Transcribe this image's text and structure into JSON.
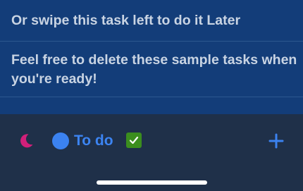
{
  "tasks": [
    {
      "text": "Or swipe this task left to do it Later"
    },
    {
      "text": "Feel free to delete these sample tasks when you're ready!"
    }
  ],
  "toolbar": {
    "mode_icon": "moon-icon",
    "status_dot_icon": "circle-icon",
    "list_label": "To do",
    "done_icon": "checkbox-checked-icon",
    "add_icon": "plus-icon"
  },
  "colors": {
    "list_background": "#133d79",
    "toolbar_background": "#1f3049",
    "accent_blue": "#3b82f0",
    "moon_pink": "#d1207a",
    "check_green": "#3b8e1e",
    "task_text": "#c9d4e3"
  }
}
